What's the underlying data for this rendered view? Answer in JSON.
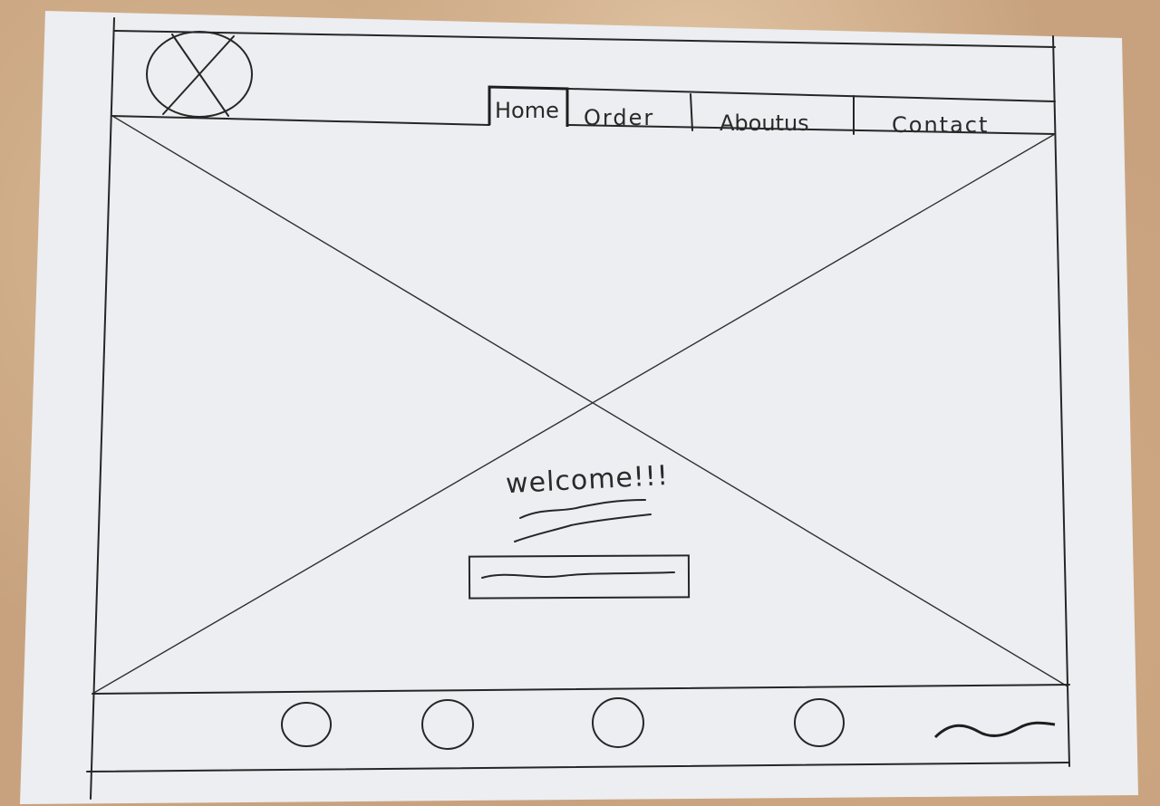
{
  "nav": {
    "tabs": [
      {
        "label": "Home"
      },
      {
        "label": "Order"
      },
      {
        "label": "Aboutus"
      },
      {
        "label": "Contact"
      }
    ]
  },
  "hero": {
    "welcome_text": "welcome!!!"
  }
}
